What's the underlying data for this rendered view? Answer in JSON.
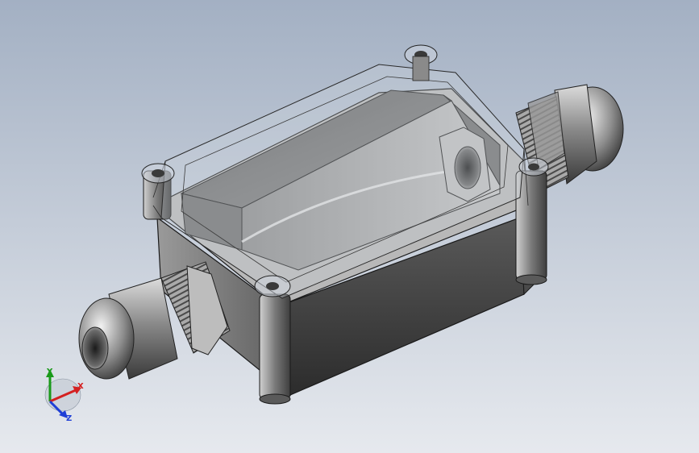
{
  "viewport": {
    "background_top": "#a3b0c3",
    "background_bottom": "#e6e9ee"
  },
  "model": {
    "part_color": "#6e6e6e",
    "dark_face": "#3a3a3a",
    "light_face": "#c9c9c9",
    "lid_tint": "#cfd6df"
  },
  "triad": {
    "x_label": "X",
    "y_label": "Y",
    "z_label": "Z",
    "x_color": "#d42020",
    "y_color": "#1a9a1a",
    "z_color": "#1f3fd6"
  }
}
